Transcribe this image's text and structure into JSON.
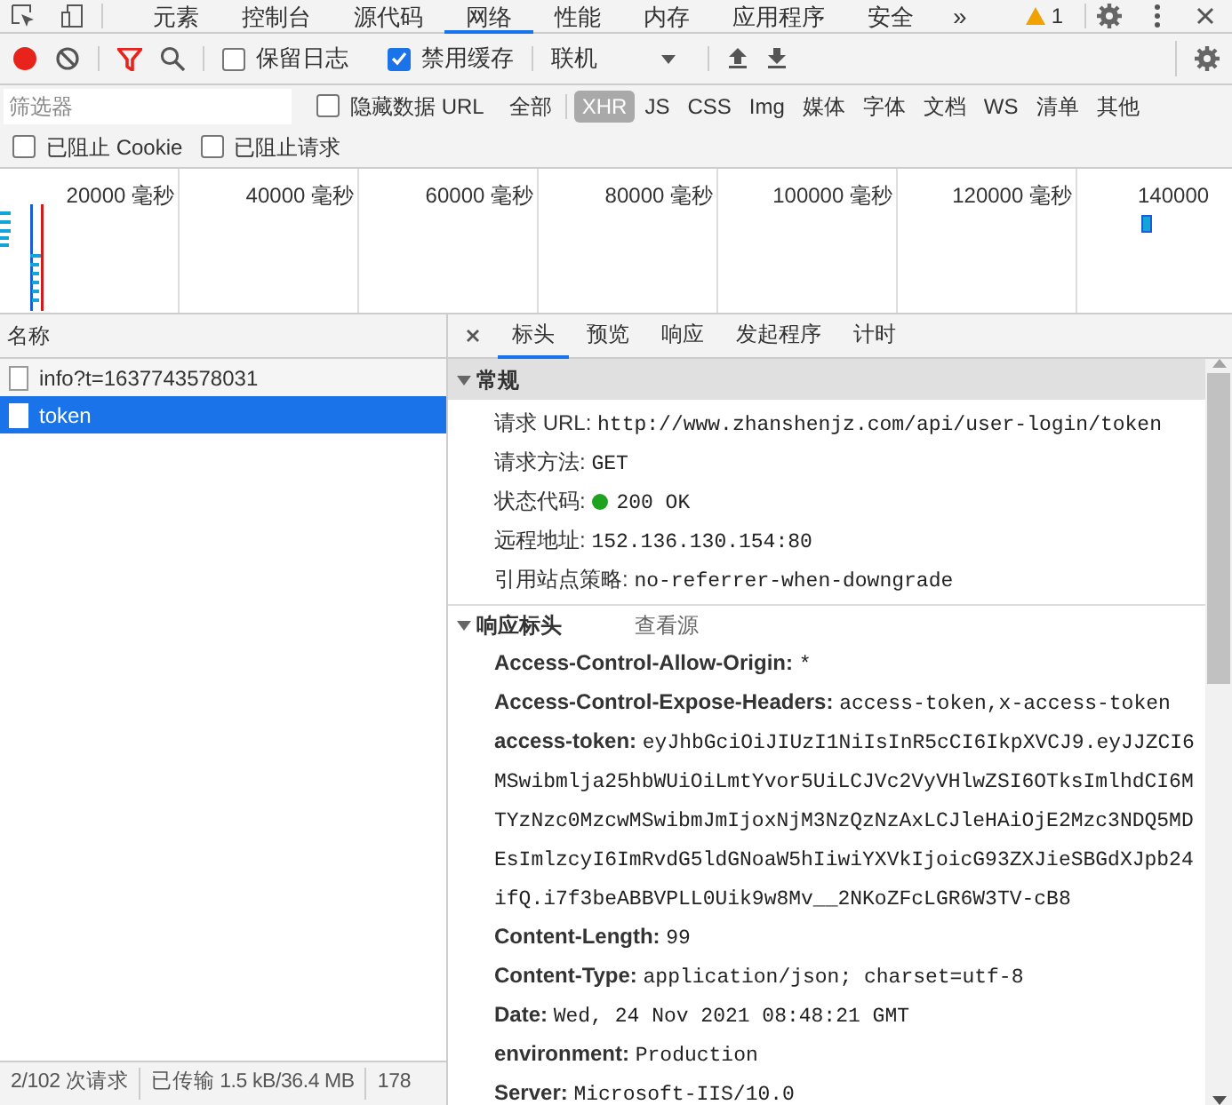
{
  "panel_tabs": [
    {
      "label": "元素",
      "selected": false
    },
    {
      "label": "控制台",
      "selected": false
    },
    {
      "label": "源代码",
      "selected": false
    },
    {
      "label": "网络",
      "selected": true
    },
    {
      "label": "性能",
      "selected": false
    },
    {
      "label": "内存",
      "selected": false
    },
    {
      "label": "应用程序",
      "selected": false
    },
    {
      "label": "安全",
      "selected": false
    }
  ],
  "more_tabs": "»",
  "warning_count": "1",
  "toolbar": {
    "recording": true,
    "preserve_log": {
      "label": "保留日志",
      "checked": false
    },
    "disable_cache": {
      "label": "禁用缓存",
      "checked": true
    },
    "throttling": "联机"
  },
  "filter": {
    "placeholder": "筛选器",
    "hide_data_urls": {
      "label": "隐藏数据 URL",
      "checked": false
    },
    "types": [
      {
        "label": "全部",
        "selected": false
      },
      {
        "label": "XHR",
        "selected": true
      },
      {
        "label": "JS",
        "selected": false
      },
      {
        "label": "CSS",
        "selected": false
      },
      {
        "label": "Img",
        "selected": false
      },
      {
        "label": "媒体",
        "selected": false
      },
      {
        "label": "字体",
        "selected": false
      },
      {
        "label": "文档",
        "selected": false
      },
      {
        "label": "WS",
        "selected": false
      },
      {
        "label": "清单",
        "selected": false
      },
      {
        "label": "其他",
        "selected": false
      }
    ]
  },
  "blocked": [
    {
      "label": "已阻止 Cookie",
      "checked": false
    },
    {
      "label": "已阻止请求",
      "checked": false
    }
  ],
  "overview_ticks": [
    "20000 毫秒",
    "40000 毫秒",
    "60000 毫秒",
    "80000 毫秒",
    "100000 毫秒",
    "120000 毫秒",
    "140000"
  ],
  "requests": {
    "column": "名称",
    "rows": [
      {
        "name": "info?t=1637743578031",
        "selected": false
      },
      {
        "name": "token",
        "selected": true
      }
    ]
  },
  "detail_tabs": [
    {
      "label": "标头",
      "selected": true
    },
    {
      "label": "预览",
      "selected": false
    },
    {
      "label": "响应",
      "selected": false
    },
    {
      "label": "发起程序",
      "selected": false
    },
    {
      "label": "计时",
      "selected": false
    }
  ],
  "general": {
    "title": "常规",
    "expanded": true,
    "items": [
      {
        "label": "请求 URL:",
        "value": "http://www.zhanshenjz.com/api/user-login/token"
      },
      {
        "label": "请求方法:",
        "value": "GET"
      },
      {
        "label": "状态代码:",
        "value": "200 OK",
        "color": "#1fa31f"
      },
      {
        "label": "远程地址:",
        "value": "152.136.130.154:80"
      },
      {
        "label": "引用站点策略:",
        "value": "no-referrer-when-downgrade"
      }
    ]
  },
  "response_headers": {
    "title": "响应标头",
    "expanded": true,
    "view_source": "查看源",
    "items": [
      {
        "label": "Access-Control-Allow-Origin:",
        "value": "*"
      },
      {
        "label": "Access-Control-Expose-Headers:",
        "value": "access-token,x-access-token"
      },
      {
        "label": "access-token:",
        "value": "eyJhbGciOiJIUzI1NiIsInR5cCI6IkpXVCJ9.eyJJZCI6MSwibmlja25hbWUiOiLmtYvor5UiLCJVc2VyVHlwZSI6OTksImlhdCI6MTYzNzc0MzcwMSwibmJmIjoxNjM3NzQzNzAxLCJleHAiOjE2Mzc3NDQ5MDEsImlzcyI6ImRvdG5ldGNoaW5hIiwiYXVkIjoicG93ZXJieSBGdXJpb24ifQ.i7f3beABBVPLL0Uik9w8Mv__2NKoZFcLGR6W3TV-cB8"
      },
      {
        "label": "Content-Length:",
        "value": "99"
      },
      {
        "label": "Content-Type:",
        "value": "application/json; charset=utf-8"
      },
      {
        "label": "Date:",
        "value": "Wed, 24 Nov 2021 08:48:21 GMT"
      },
      {
        "label": "environment:",
        "value": "Production"
      },
      {
        "label": "Server:",
        "value": "Microsoft-IIS/10.0"
      }
    ]
  },
  "status_bar": [
    "2/102 次请求",
    "已传输 1.5 kB/36.4 MB",
    "178"
  ]
}
